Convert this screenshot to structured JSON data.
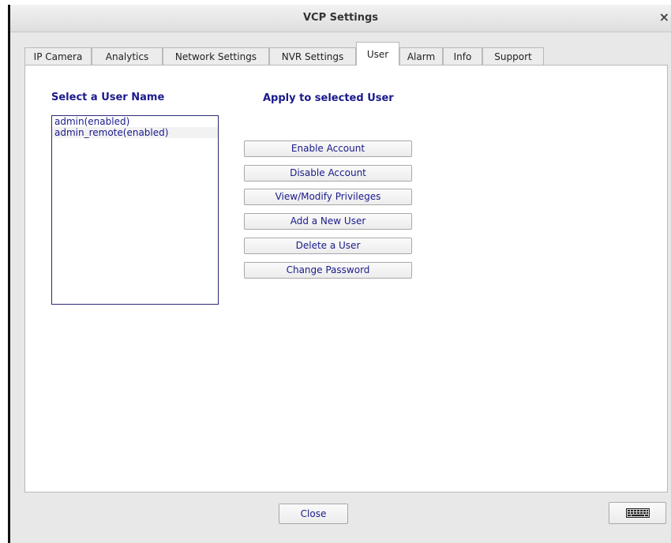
{
  "window": {
    "title": "VCP Settings",
    "close_glyph": "×"
  },
  "tabs": [
    {
      "label": "IP Camera",
      "active": false
    },
    {
      "label": "Analytics",
      "active": false
    },
    {
      "label": "Network Settings",
      "active": false
    },
    {
      "label": "NVR Settings",
      "active": false
    },
    {
      "label": "User",
      "active": true
    },
    {
      "label": "Alarm",
      "active": false
    },
    {
      "label": "Info",
      "active": false
    },
    {
      "label": "Support",
      "active": false
    }
  ],
  "user_panel": {
    "select_heading": "Select a User Name",
    "apply_heading": "Apply to selected User",
    "users": [
      "admin(enabled)",
      "admin_remote(enabled)"
    ],
    "actions": [
      "Enable Account",
      "Disable Account",
      "View/Modify Privileges",
      "Add a New User",
      "Delete a User",
      "Change Password"
    ]
  },
  "footer": {
    "close_label": "Close",
    "keyboard_icon": "keyboard-icon"
  },
  "colors": {
    "accent_text": "#1a1a8c",
    "panel_bg": "#ffffff",
    "window_bg": "#e8e8e8"
  }
}
